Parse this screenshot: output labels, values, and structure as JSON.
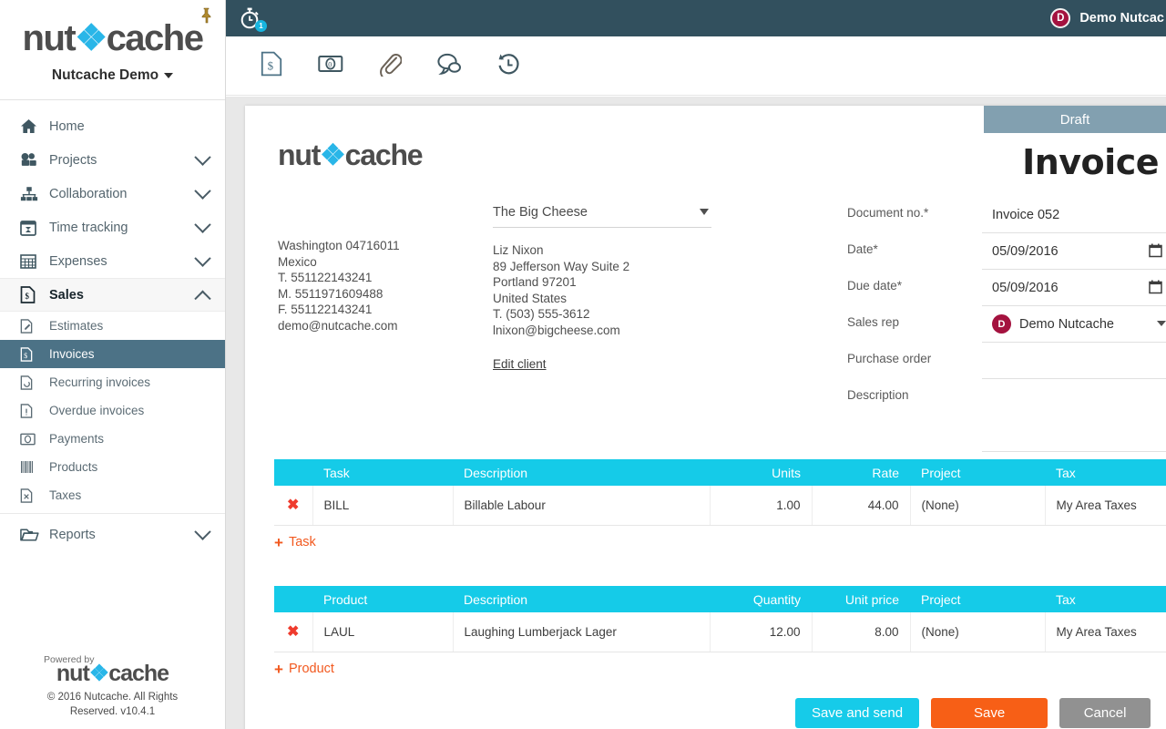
{
  "sidebar": {
    "logo_text_1": "nut",
    "logo_text_2": "cache",
    "org_name": "Nutcache Demo",
    "pin_icon": "pin-icon",
    "items": [
      {
        "label": "Home",
        "icon": "home-icon",
        "expandable": false
      },
      {
        "label": "Projects",
        "icon": "projects-icon",
        "expandable": true
      },
      {
        "label": "Collaboration",
        "icon": "collaboration-icon",
        "expandable": true
      },
      {
        "label": "Time tracking",
        "icon": "time-tracking-icon",
        "expandable": true
      },
      {
        "label": "Expenses",
        "icon": "expenses-icon",
        "expandable": true
      },
      {
        "label": "Sales",
        "icon": "sales-icon",
        "expandable": true,
        "expanded": true,
        "active": true
      }
    ],
    "sub_items": [
      {
        "label": "Estimates",
        "icon": "estimates-icon",
        "selected": false
      },
      {
        "label": "Invoices",
        "icon": "invoices-icon",
        "selected": true
      },
      {
        "label": "Recurring invoices",
        "icon": "recurring-invoices-icon",
        "selected": false
      },
      {
        "label": "Overdue invoices",
        "icon": "overdue-invoices-icon",
        "selected": false
      },
      {
        "label": "Payments",
        "icon": "payments-icon",
        "selected": false
      },
      {
        "label": "Products",
        "icon": "products-icon",
        "selected": false
      },
      {
        "label": "Taxes",
        "icon": "taxes-icon",
        "selected": false
      }
    ],
    "reports": {
      "label": "Reports",
      "icon": "reports-folder-icon",
      "expandable": true
    },
    "footer": {
      "powered_by": "Powered by",
      "logo_text_1": "nut",
      "logo_text_2": "cache",
      "copyright_line1": "© 2016 Nutcache. All Rights",
      "copyright_line2": "Reserved. v10.4.1"
    }
  },
  "topbar": {
    "timer_icon": "stopwatch-icon",
    "timer_badge": "1",
    "user_initial": "D",
    "user_name": "Demo Nutcac"
  },
  "tabs": [
    {
      "name": "invoice-tab",
      "icon": "invoice-document-icon",
      "active": true
    },
    {
      "name": "payments-tab",
      "icon": "banknote-icon",
      "active": false
    },
    {
      "name": "attachments-tab",
      "icon": "paperclip-icon",
      "active": false
    },
    {
      "name": "comments-tab",
      "icon": "speech-bubble-icon",
      "active": false
    },
    {
      "name": "history-tab",
      "icon": "history-clock-icon",
      "active": false
    }
  ],
  "invoice": {
    "status_badge": "Draft",
    "title": "Invoice",
    "logo_text_1": "nut",
    "logo_text_2": "cache",
    "own_address": [
      "Washington 04716011",
      "Mexico",
      "T. 551122143241",
      "M. 5511971609488",
      "F. 551122143241",
      "demo@nutcache.com"
    ],
    "client_selected": "The Big Cheese",
    "client_address": [
      "Liz Nixon",
      "89 Jefferson Way Suite 2",
      "Portland 97201",
      "United States",
      "T. (503) 555-3612",
      "lnixon@bigcheese.com"
    ],
    "edit_client_label": "Edit client",
    "fields": [
      {
        "label": "Document no.*",
        "value": "Invoice 052",
        "type": "text"
      },
      {
        "label": "Date*",
        "value": "05/09/2016",
        "type": "date"
      },
      {
        "label": "Due date*",
        "value": "05/09/2016",
        "type": "date"
      },
      {
        "label": "Sales rep",
        "value": "Demo Nutcache",
        "type": "select",
        "avatar_initial": "D"
      },
      {
        "label": "Purchase order",
        "value": "",
        "type": "text"
      },
      {
        "label": "Description",
        "value": "",
        "type": "textarea"
      }
    ]
  },
  "task_table": {
    "columns": [
      "",
      "Task",
      "Description",
      "Units",
      "Rate",
      "Project",
      "Tax"
    ],
    "rows": [
      {
        "delete_icon": "✖",
        "code": "BILL",
        "description": "Billable Labour",
        "units": "1.00",
        "rate": "44.00",
        "project": "(None)",
        "tax": "My Area Taxes"
      }
    ],
    "add_label": "Task",
    "add_plus": "+"
  },
  "product_table": {
    "columns": [
      "",
      "Product",
      "Description",
      "Quantity",
      "Unit price",
      "Project",
      "Tax"
    ],
    "rows": [
      {
        "delete_icon": "✖",
        "code": "LAUL",
        "description": "Laughing Lumberjack Lager",
        "quantity": "12.00",
        "unit_price": "8.00",
        "project": "(None)",
        "tax": "My Area Taxes"
      }
    ],
    "add_label": "Product",
    "add_plus": "+"
  },
  "actions": {
    "save_and_send": "Save and send",
    "save": "Save",
    "cancel": "Cancel"
  },
  "colors": {
    "brand_blue": "#29b6e8",
    "table_header": "#15cbe8",
    "topbar": "#32505e",
    "sidebar_selected": "#4c7286",
    "accent_orange": "#f75f16",
    "add_link": "#f2591f",
    "avatar": "#a4123f",
    "draft_badge": "#82a0b0",
    "delete_red": "#ef3b2d",
    "cancel_gray": "#919191"
  }
}
